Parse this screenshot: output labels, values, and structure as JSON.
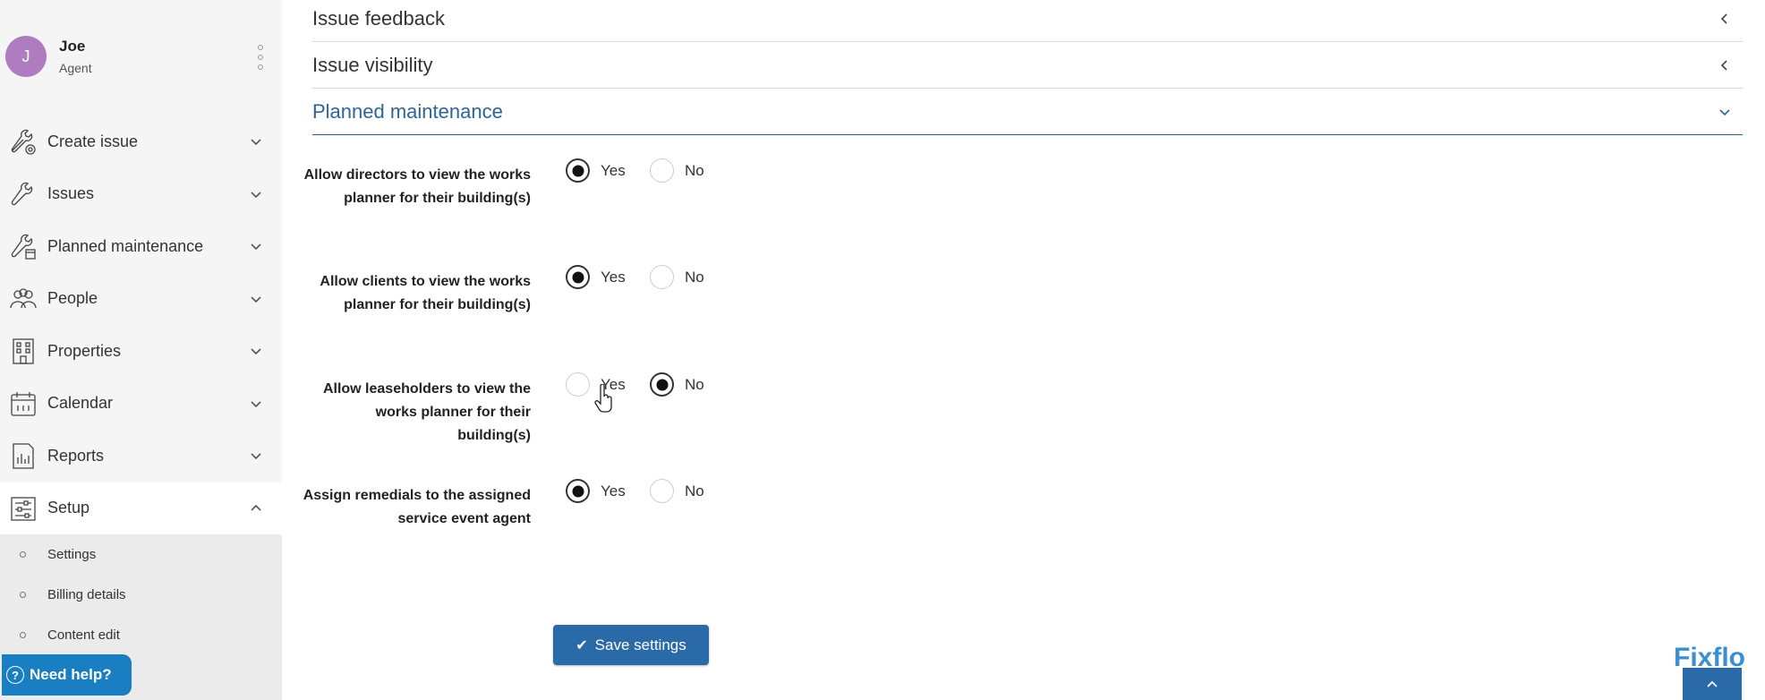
{
  "user": {
    "initial": "J",
    "name": "Joe",
    "role": "Agent"
  },
  "nav": [
    {
      "label": "Create issue",
      "icon": "wrench-gear-icon"
    },
    {
      "label": "Issues",
      "icon": "wrench-icon"
    },
    {
      "label": "Planned maintenance",
      "icon": "wrench-calendar-icon"
    },
    {
      "label": "People",
      "icon": "people-icon"
    },
    {
      "label": "Properties",
      "icon": "building-icon"
    },
    {
      "label": "Calendar",
      "icon": "calendar-icon"
    },
    {
      "label": "Reports",
      "icon": "report-icon"
    },
    {
      "label": "Setup",
      "icon": "sliders-icon"
    }
  ],
  "submenu": [
    "Settings",
    "Billing details",
    "Content edit"
  ],
  "help": {
    "label": "Need help?",
    "icon_glyph": "?"
  },
  "accordions": [
    "Issue feedback",
    "Issue visibility",
    "Planned maintenance"
  ],
  "settings": [
    {
      "label": "Allow directors to view the works planner for their building(s)",
      "yes": "Yes",
      "no": "No",
      "selected": "yes"
    },
    {
      "label": "Allow clients to view the works planner for their building(s)",
      "yes": "Yes",
      "no": "No",
      "selected": "yes"
    },
    {
      "label": "Allow leaseholders to view the works planner for their building(s)",
      "yes": "Yes",
      "no": "No",
      "selected": "no"
    },
    {
      "label": "Assign remedials to the assigned service event agent",
      "yes": "Yes",
      "no": "No",
      "selected": "yes"
    }
  ],
  "save": {
    "label": "Save settings",
    "glyph": "✔"
  },
  "brand": {
    "name": "Fixflo"
  },
  "colors": {
    "accent": "#2a6aa8",
    "help": "#1a7fc2",
    "avatar": "#b07cc0",
    "active_accordion": "#2e6597"
  }
}
